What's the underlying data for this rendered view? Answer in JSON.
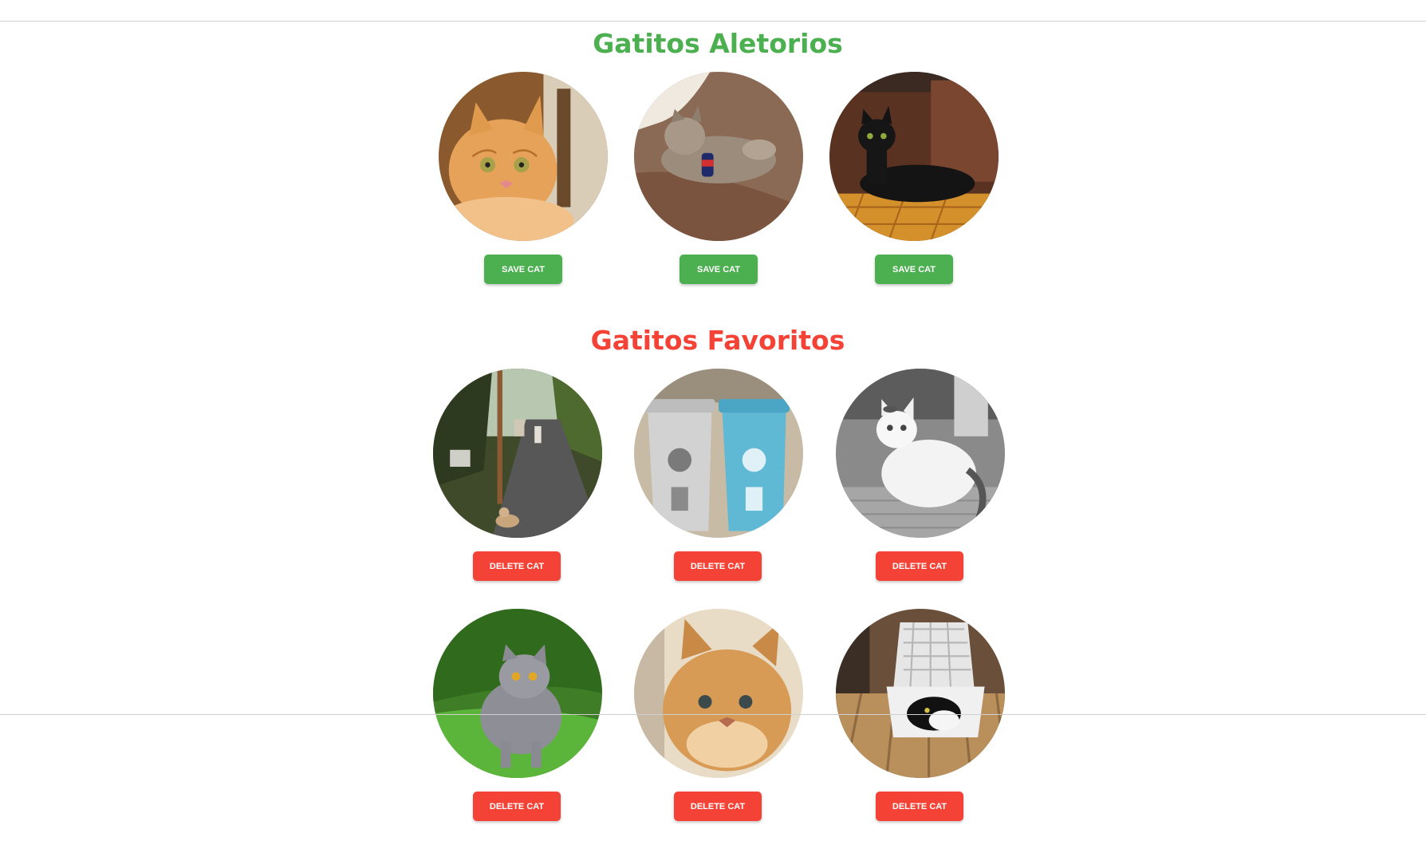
{
  "random_section": {
    "title": "Gatitos Aletorios",
    "title_color": "#4caf50",
    "cats": [
      {
        "image": "orange-tabby-cat-photo",
        "button_label": "SAVE CAT"
      },
      {
        "image": "fluffy-gray-cat-with-soda-can-photo",
        "button_label": "SAVE CAT"
      },
      {
        "image": "black-cat-on-rug-photo",
        "button_label": "SAVE CAT"
      }
    ]
  },
  "favorites_section": {
    "title": "Gatitos Favoritos",
    "title_color": "#f44336",
    "cats": [
      {
        "image": "street-cat-photo",
        "button_label": "DELETE CAT"
      },
      {
        "image": "recycling-bins-photo",
        "button_label": "DELETE CAT"
      },
      {
        "image": "white-cat-black-and-white-photo",
        "button_label": "DELETE CAT"
      },
      {
        "image": "gray-british-shorthair-on-grass-photo",
        "button_label": "DELETE CAT"
      },
      {
        "image": "golden-kitten-photo",
        "button_label": "DELETE CAT"
      },
      {
        "image": "black-white-cat-in-basket-photo",
        "button_label": "DELETE CAT"
      }
    ]
  },
  "colors": {
    "save_button": "#4caf50",
    "delete_button": "#f44336"
  }
}
